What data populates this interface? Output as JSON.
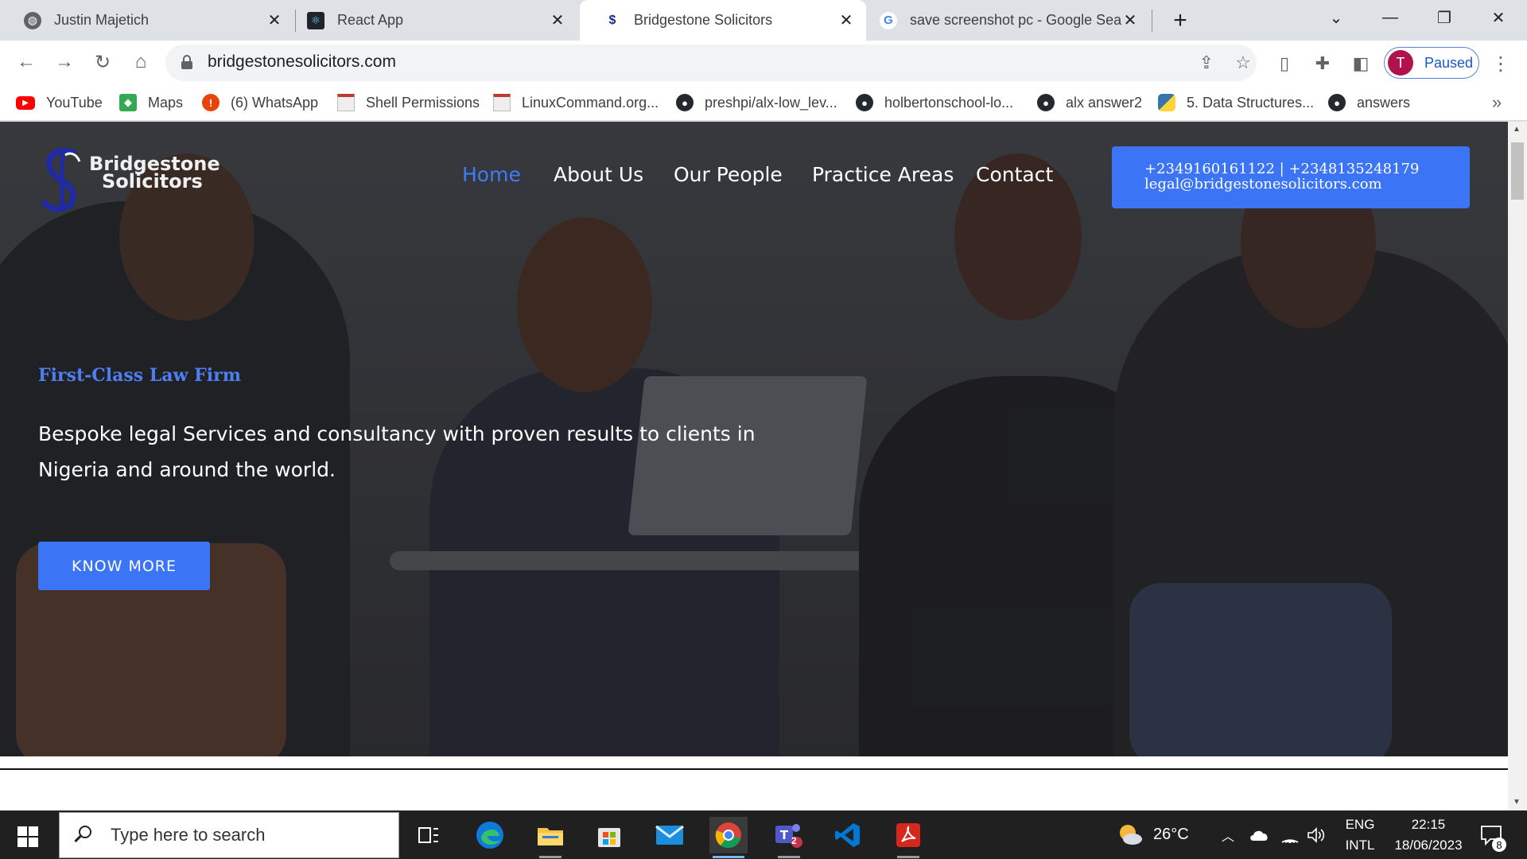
{
  "tabs": [
    {
      "title": "Justin Majetich",
      "icon": "globe-icon"
    },
    {
      "title": "React App",
      "icon": "react-icon"
    },
    {
      "title": "Bridgestone Solicitors",
      "icon": "bridgestone-favicon",
      "active": true
    },
    {
      "title": "save screenshot pc - Google Sear",
      "icon": "google-icon"
    }
  ],
  "toolbar": {
    "url": "bridgestonesolicitors.com",
    "profile_initial": "T",
    "profile_label": "Paused"
  },
  "bookmarks": [
    {
      "label": "YouTube",
      "icon": "youtube-icon"
    },
    {
      "label": "Maps",
      "icon": "maps-icon"
    },
    {
      "label": "(6) WhatsApp",
      "icon": "whatsapp-alert-icon"
    },
    {
      "label": "Shell Permissions",
      "icon": "document-icon"
    },
    {
      "label": "LinuxCommand.org...",
      "icon": "document-icon"
    },
    {
      "label": "preshpi/alx-low_lev...",
      "icon": "github-icon"
    },
    {
      "label": "holbertonschool-lo...",
      "icon": "github-icon"
    },
    {
      "label": "alx answer2",
      "icon": "github-icon"
    },
    {
      "label": "5. Data Structures...",
      "icon": "python-icon"
    },
    {
      "label": "answers",
      "icon": "github-icon"
    }
  ],
  "site": {
    "logo_line1": "Bridgestone",
    "logo_line2": "Solicitors",
    "nav": [
      "Home",
      "About Us",
      "Our People",
      "Practice Areas",
      "Contact"
    ],
    "nav_active": "Home",
    "phones": "+2349160161122 | +2348135248179",
    "email": "legal@bridgestonesolicitors.com",
    "kicker": "First-Class Law Firm",
    "lead": "Bespoke legal Services and consultancy with proven results to clients in Nigeria and around the world.",
    "cta": "KNOW MORE"
  },
  "taskbar": {
    "search_placeholder": "Type here to search",
    "weather": "26°C",
    "lang_top": "ENG",
    "lang_bottom": "INTL",
    "time": "22:15",
    "date": "18/06/2023",
    "notifications": "8",
    "teams_badge": "2"
  },
  "colors": {
    "accent_blue": "#3b74f5",
    "nav_active": "#3f7bf6",
    "kicker": "#4e7ff2"
  }
}
